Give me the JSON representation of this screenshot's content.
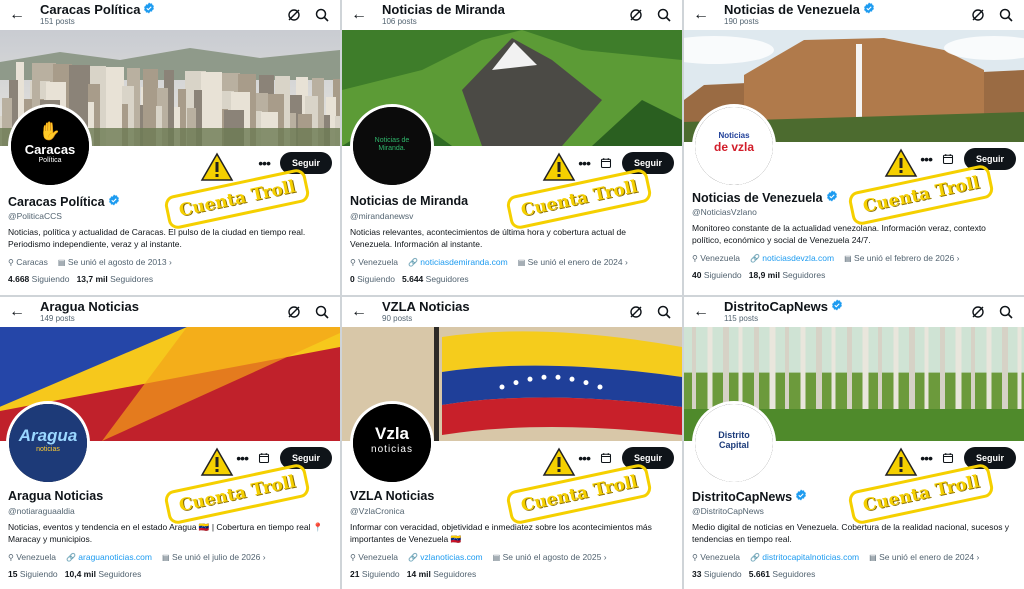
{
  "stamp_text": "Cuenta Troll",
  "follow_label": "Seguir",
  "following_label": "Siguiendo",
  "followers_label": "Seguidores",
  "colors": {
    "link": "#1d9bf0",
    "verified": "#1d9bf0",
    "stamp": "#f5d000"
  },
  "panels": [
    {
      "title": "Caracas Política",
      "posts": "151 posts",
      "verified": true,
      "name": "Caracas Política",
      "handle": "@PoliticaCCS",
      "bio": "Noticias, política y actualidad de Caracas. El pulso de la ciudad en tiempo real. Periodismo independiente, veraz y al instante.",
      "location": "Caracas",
      "link": "",
      "joined": "Se unió el agosto de 2013",
      "following": "4.668",
      "followers": "13,7 mil",
      "avatar_text_1": "Caracas",
      "avatar_text_2": "Política"
    },
    {
      "title": "Noticias de Miranda",
      "posts": "106 posts",
      "verified": false,
      "name": "Noticias de Miranda",
      "handle": "@mirandanewsv",
      "bio": "Noticias relevantes, acontecimientos de última hora y cobertura actual de Venezuela. Información al instante.",
      "location": "Venezuela",
      "link": "noticiasdemiranda.com",
      "joined": "Se unió el enero de 2024",
      "following": "0",
      "followers": "5.644",
      "avatar_text_1": "Noticias de",
      "avatar_text_2": "Miranda."
    },
    {
      "title": "Noticias de Venezuela",
      "posts": "190 posts",
      "verified": true,
      "name": "Noticias de Venezuela",
      "handle": "@NoticiasVzlano",
      "bio": "Monitoreo constante de la actualidad venezolana. Información veraz, contexto político, económico y social de Venezuela 24/7.",
      "location": "Venezuela",
      "link": "noticiasdevzla.com",
      "joined": "Se unió el febrero de 2026",
      "following": "40",
      "followers": "18,9 mil",
      "avatar_text_1": "Noticias",
      "avatar_text_2": "de vzla"
    },
    {
      "title": "Aragua Noticias",
      "posts": "149 posts",
      "verified": false,
      "name": "Aragua Noticias",
      "handle": "@notiaraguaaldia",
      "bio": "Noticias, eventos y tendencia en el estado Aragua 🇻🇪 | Cobertura en tiempo real 📍 Maracay y municipios.",
      "location": "Venezuela",
      "link": "araguanoticias.com",
      "joined": "Se unió el julio de 2026",
      "following": "15",
      "followers": "10,4 mil",
      "avatar_text_1": "Aragua",
      "avatar_text_2": "noticias"
    },
    {
      "title": "VZLA Noticias",
      "posts": "90 posts",
      "verified": false,
      "name": "VZLA Noticias",
      "handle": "@VzlaCronica",
      "bio": "Informar con veracidad, objetividad e inmediatez sobre los acontecimientos más importantes de Venezuela 🇻🇪",
      "location": "Venezuela",
      "link": "vzlanoticias.com",
      "joined": "Se unió el agosto de 2025",
      "following": "21",
      "followers": "14 mil",
      "avatar_text_1": "Vzla",
      "avatar_text_2": "noticias"
    },
    {
      "title": "DistritoCapNews",
      "posts": "115 posts",
      "verified": true,
      "name": "DistritoCapNews",
      "handle": "@DistritoCapNews",
      "bio": "Medio digital de noticias en Venezuela. Cobertura de la realidad nacional, sucesos y tendencias en tiempo real.",
      "location": "Venezuela",
      "link": "distritocapitalnoticias.com",
      "joined": "Se unió el enero de 2024",
      "following": "33",
      "followers": "5.661",
      "avatar_text_1": "Distrito",
      "avatar_text_2": "Capital"
    }
  ]
}
